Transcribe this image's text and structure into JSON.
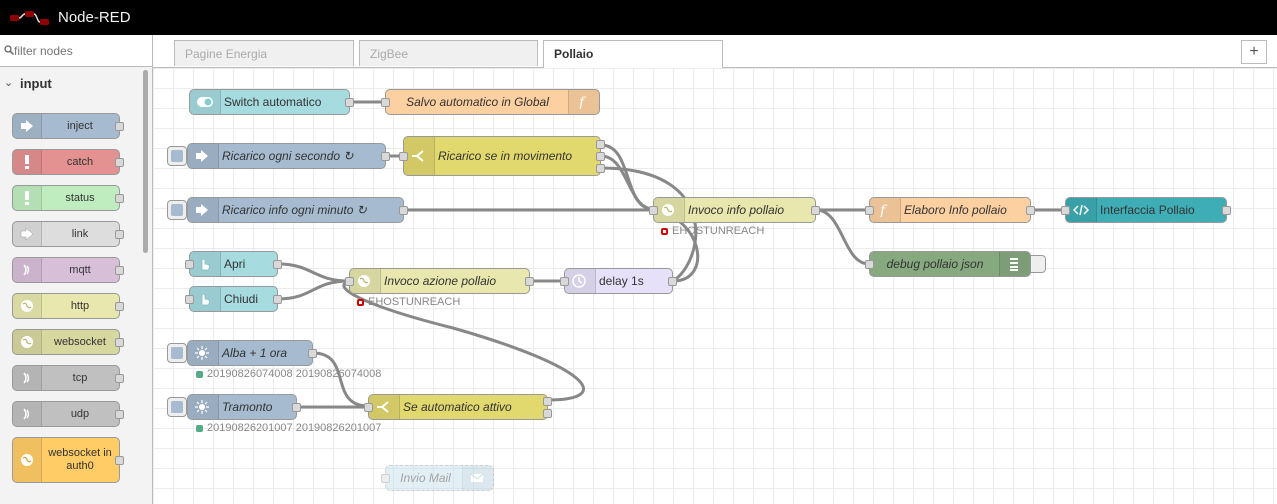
{
  "app": {
    "title": "Node-RED"
  },
  "palette": {
    "filter_placeholder": "filter nodes",
    "category": "input",
    "nodes": [
      {
        "label": "inject",
        "color": "#a6bbcf",
        "icon": "inject-arrow-icon"
      },
      {
        "label": "catch",
        "color": "#e49191",
        "icon": "exclamation-icon"
      },
      {
        "label": "status",
        "color": "#c0edc0",
        "icon": "exclamation-icon"
      },
      {
        "label": "link",
        "color": "#dddddd",
        "icon": "link-arrow-icon"
      },
      {
        "label": "mqtt",
        "color": "#d8bfd8",
        "icon": "bridge-icon"
      },
      {
        "label": "http",
        "color": "#e7e7ae",
        "icon": "globe-icon"
      },
      {
        "label": "websocket",
        "color": "#d7d7a0",
        "icon": "globe-icon"
      },
      {
        "label": "tcp",
        "color": "#c0c0c0",
        "icon": "bridge-icon"
      },
      {
        "label": "udp",
        "color": "#c0c0c0",
        "icon": "bridge-icon"
      },
      {
        "label": "websocket in auth0",
        "color": "#ffcc66",
        "icon": "globe-icon"
      }
    ]
  },
  "tabs": [
    {
      "label": "Pagine Energia",
      "active": false
    },
    {
      "label": "ZigBee",
      "active": false
    },
    {
      "label": "Pollaio",
      "active": true
    }
  ],
  "add_tab_label": "+",
  "flow": {
    "nodes": {
      "switch_auto": {
        "label": "Switch automatico",
        "color": "#a6dbe0",
        "icon": "toggle-icon"
      },
      "salvo_auto": {
        "label": "Salvo automatico in Global",
        "color": "#fdd0a2",
        "icon": "function-icon"
      },
      "ricarico_sec": {
        "label": "Ricarico ogni secondo ↻",
        "color": "#a6bbcf",
        "icon": "inject-arrow-icon"
      },
      "ricarico_mov": {
        "label": "Ricarico se in movimento",
        "color": "#e2d96e",
        "icon": "switch-icon"
      },
      "ricarico_min": {
        "label": "Ricarico info ogni minuto ↻",
        "color": "#a6bbcf",
        "icon": "inject-arrow-icon"
      },
      "invoco_info": {
        "label": "Invoco info pollaio",
        "color": "#e7e7ae",
        "icon": "globe-icon",
        "status": "EHOSTUNREACH"
      },
      "elaboro": {
        "label": "Elaboro Info pollaio",
        "color": "#fdd0a2",
        "icon": "function-icon"
      },
      "interfaccia": {
        "label": "Interfaccia Pollaio",
        "color": "#3fadb5",
        "icon": "template-icon"
      },
      "debug": {
        "label": "debug pollaio json",
        "color": "#87a980",
        "icon": "debug-list-icon"
      },
      "apri": {
        "label": "Apri",
        "color": "#a6dbe0",
        "icon": "hand-icon"
      },
      "chiudi": {
        "label": "Chiudi",
        "color": "#a6dbe0",
        "icon": "hand-icon"
      },
      "invoco_azione": {
        "label": "Invoco azione pollaio",
        "color": "#e7e7ae",
        "icon": "globe-icon",
        "status": "EHOSTUNREACH"
      },
      "delay": {
        "label": "delay 1s",
        "color": "#e6e0f8",
        "icon": "timer-icon"
      },
      "alba": {
        "label": "Alba + 1 ora",
        "color": "#a6bbcf",
        "icon": "sun-icon",
        "status": "20190826074008 20190826074008"
      },
      "tramonto": {
        "label": "Tramonto",
        "color": "#a6bbcf",
        "icon": "sun-icon",
        "status": "20190826201007 20190826201007"
      },
      "se_auto": {
        "label": "Se automatico attivo",
        "color": "#e2d96e",
        "icon": "switch-icon"
      },
      "invio_mail": {
        "label": "Invio Mail",
        "color": "#c0deed",
        "icon": "envelope-icon"
      }
    }
  }
}
